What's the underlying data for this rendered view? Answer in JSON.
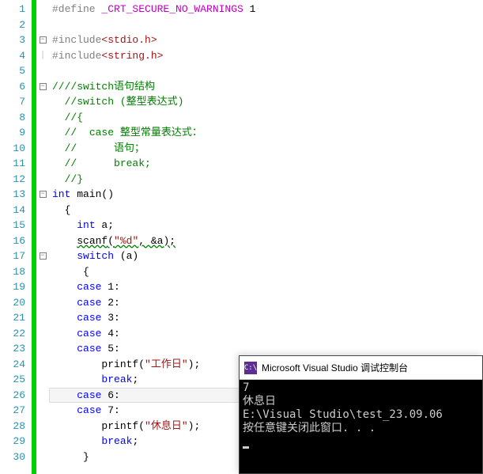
{
  "editor": {
    "line_count": 30,
    "highlighted_line": 26,
    "lines": {
      "l1_define": "#define",
      "l1_macro": " _CRT_SECURE_NO_WARNINGS",
      "l1_val": " 1",
      "l3_inc": "#include",
      "l3_hdr": "<stdio.h>",
      "l4_inc": "#include",
      "l4_hdr": "<string.h>",
      "l6": "////switch语句结构",
      "l7": "//switch (整型表达式)",
      "l8": "//{",
      "l9": "//  case 整型常量表达式：",
      "l10": "//      语句；",
      "l11": "//      break;",
      "l12": "//}",
      "l13_kw": "int",
      "l13_fn": " main",
      "l13_paren": "()",
      "l14": "{",
      "l15_kw": "int",
      "l15_rest": " a;",
      "l16_fn": "scanf",
      "l16_open": "(",
      "l16_str": "\"%d\"",
      "l16_mid": ", &a",
      "l16_close": ");",
      "l17_kw": "switch",
      "l17_rest": " (a)",
      "l18": "{",
      "l19_kw": "case",
      "l19_v": " 1:",
      "l20_kw": "case",
      "l20_v": " 2:",
      "l21_kw": "case",
      "l21_v": " 3:",
      "l22_kw": "case",
      "l22_v": " 4:",
      "l23_kw": "case",
      "l23_v": " 5:",
      "l24_fn": "printf",
      "l24_open": "(",
      "l24_str": "\"工作日\"",
      "l24_close": ");",
      "l25_kw": "break",
      "l25_semi": ";",
      "l26_kw": "case",
      "l26_v": " 6:",
      "l27_kw": "case",
      "l27_v": " 7:",
      "l28_fn": "printf",
      "l28_open": "(",
      "l28_str": "\"休息日\"",
      "l28_close": ");",
      "l29_kw": "break",
      "l29_semi": ";",
      "l30": "}"
    }
  },
  "console": {
    "icon_text": "C:\\",
    "title": "Microsoft Visual Studio 调试控制台",
    "lines": [
      "7",
      "休息日",
      "E:\\Visual Studio\\test_23.09.06",
      "按任意键关闭此窗口. . ."
    ]
  }
}
